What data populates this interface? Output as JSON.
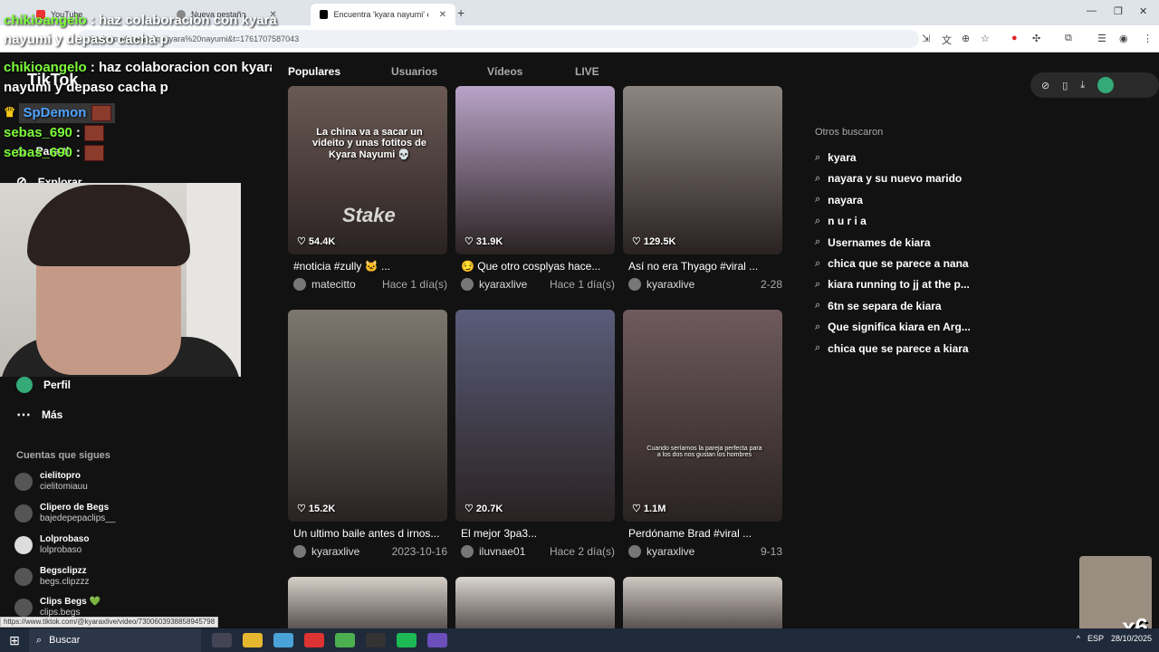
{
  "browser": {
    "tabs": [
      {
        "label": "YouTube"
      },
      {
        "label": "Nueva pestaña"
      },
      {
        "label": "Encuentra 'kyara nayumi' en Ti"
      }
    ],
    "url": "tiktok.com/search?q=kyara%20nayumi&t=1761707587043",
    "status_url": "https://www.tiktok.com/@kyaraxlive/video/7300603938858945798"
  },
  "overlay": {
    "user": "chikioangelo",
    "message": ": haz colaboracion con kyara nayumi y depaso cacha p"
  },
  "chat": [
    {
      "user": "chikioangelo",
      "message": ": haz colaboracion con kyara nayumi y depaso cacha p"
    },
    {
      "user": "sebas_690",
      "message": ":"
    },
    {
      "user": "sebas_690",
      "message": ":"
    }
  ],
  "chat_badge": "SpDemon",
  "sidebar": {
    "logo": "TikTok",
    "nav": [
      {
        "label": "Para ti"
      },
      {
        "label": "Explorar"
      },
      {
        "label": "Perfil"
      },
      {
        "label": "Más"
      }
    ],
    "follow_title": "Cuentas que sigues",
    "accounts": [
      {
        "name": "cielitopro",
        "handle": "cielitomiauu"
      },
      {
        "name": "Clipero de Begs",
        "handle": "bajedepepaclips__"
      },
      {
        "name": "Lolprobaso",
        "handle": "lolprobaso"
      },
      {
        "name": "Begsclipzz",
        "handle": "begs.clipzzz"
      },
      {
        "name": "Clips Begs 💚",
        "handle": "clips.begs"
      }
    ]
  },
  "search_tabs": [
    "Populares",
    "Usuarios",
    "Vídeos",
    "LIVE"
  ],
  "videos": [
    {
      "likes": "54.4K",
      "caption": "#noticia #zully 🐱 ...",
      "author": "matecitto",
      "date": "Hace 1 día(s)",
      "overlay": "La china va a sacar un videito y unas fotitos de Kyara Nayumi 💀",
      "watermark": "Stake",
      "color": "#6b5a55"
    },
    {
      "likes": "31.9K",
      "caption": "😏 Que otro cosplyas hace...",
      "author": "kyaraxlive",
      "date": "Hace 1 día(s)",
      "overlay": "",
      "watermark": "",
      "color": "#b9a3c8"
    },
    {
      "likes": "129.5K",
      "caption": "Así no era Thyago #viral ...",
      "author": "kyaraxlive",
      "date": "2-28",
      "overlay": "",
      "watermark": "",
      "color": "#8d8680"
    },
    {
      "likes": "15.2K",
      "caption": "Un ultimo baile antes d irnos...",
      "author": "kyaraxlive",
      "date": "2023-10-16",
      "overlay": "",
      "watermark": "",
      "color": "#7d776f"
    },
    {
      "likes": "20.7K",
      "caption": "El mejor 3pa3...",
      "author": "iluvnae01",
      "date": "Hace 2 día(s)",
      "overlay": "",
      "watermark": "",
      "color": "#5a5d7a"
    },
    {
      "likes": "1.1M",
      "caption": "Perdóname Brad #viral ...",
      "author": "kyaraxlive",
      "date": "9-13",
      "overlay": "Cuando seríamos la pareja perfecta para a los dos nos gustan los hombres",
      "watermark": "",
      "color": "#6e5a5c"
    },
    {
      "likes": "",
      "caption": "",
      "author": "",
      "date": "",
      "overlay": "",
      "watermark": "",
      "color": "#d6cfc8"
    },
    {
      "likes": "",
      "caption": "",
      "author": "",
      "date": "",
      "overlay": "",
      "watermark": "",
      "color": "#d9d5d0"
    },
    {
      "likes": "",
      "caption": "",
      "author": "",
      "date": "",
      "overlay": "",
      "watermark": "",
      "color": "#cfc8c1"
    }
  ],
  "others": {
    "title": "Otros buscaron",
    "items": [
      "kyara",
      "nayara y su nuevo marido",
      "nayara",
      "n u r i a",
      "Usernames de kiara",
      "chica que se parece a nana",
      "kiara running to jj at the p...",
      "6tn se separa de kiara",
      "Que significa kiara en Arg...",
      "chica que se parece a kiara"
    ]
  },
  "monkey_badge": "x6",
  "taskbar": {
    "search": "Buscar",
    "lang": "ESP",
    "date": "28/10/2025"
  }
}
